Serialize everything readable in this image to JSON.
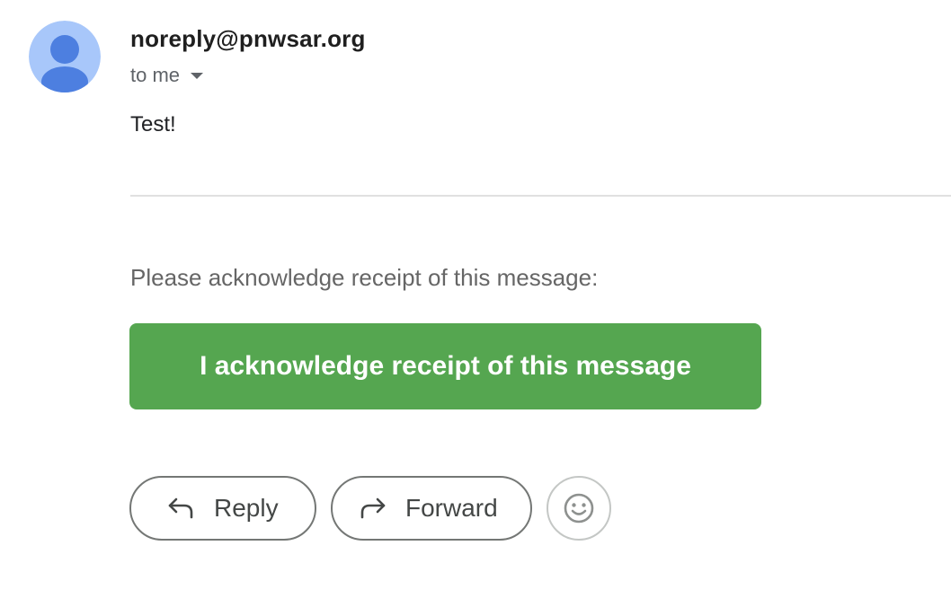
{
  "message": {
    "sender": "noreply@pnwsar.org",
    "recipient_label": "to me",
    "body": "Test!",
    "ack_prompt": "Please acknowledge receipt of this message:",
    "ack_button_label": "I acknowledge receipt of this message"
  },
  "actions": {
    "reply_label": "Reply",
    "forward_label": "Forward"
  },
  "icons": {
    "avatar": "person-avatar-icon",
    "recipient_details": "caret-down-icon",
    "reply": "reply-arrow-icon",
    "forward": "forward-arrow-icon",
    "emoji": "smiley-face-icon"
  },
  "colors": {
    "ack_button": "#55a650",
    "avatar_background": "#a8c7fa",
    "avatar_figure": "#4d7fe0"
  }
}
